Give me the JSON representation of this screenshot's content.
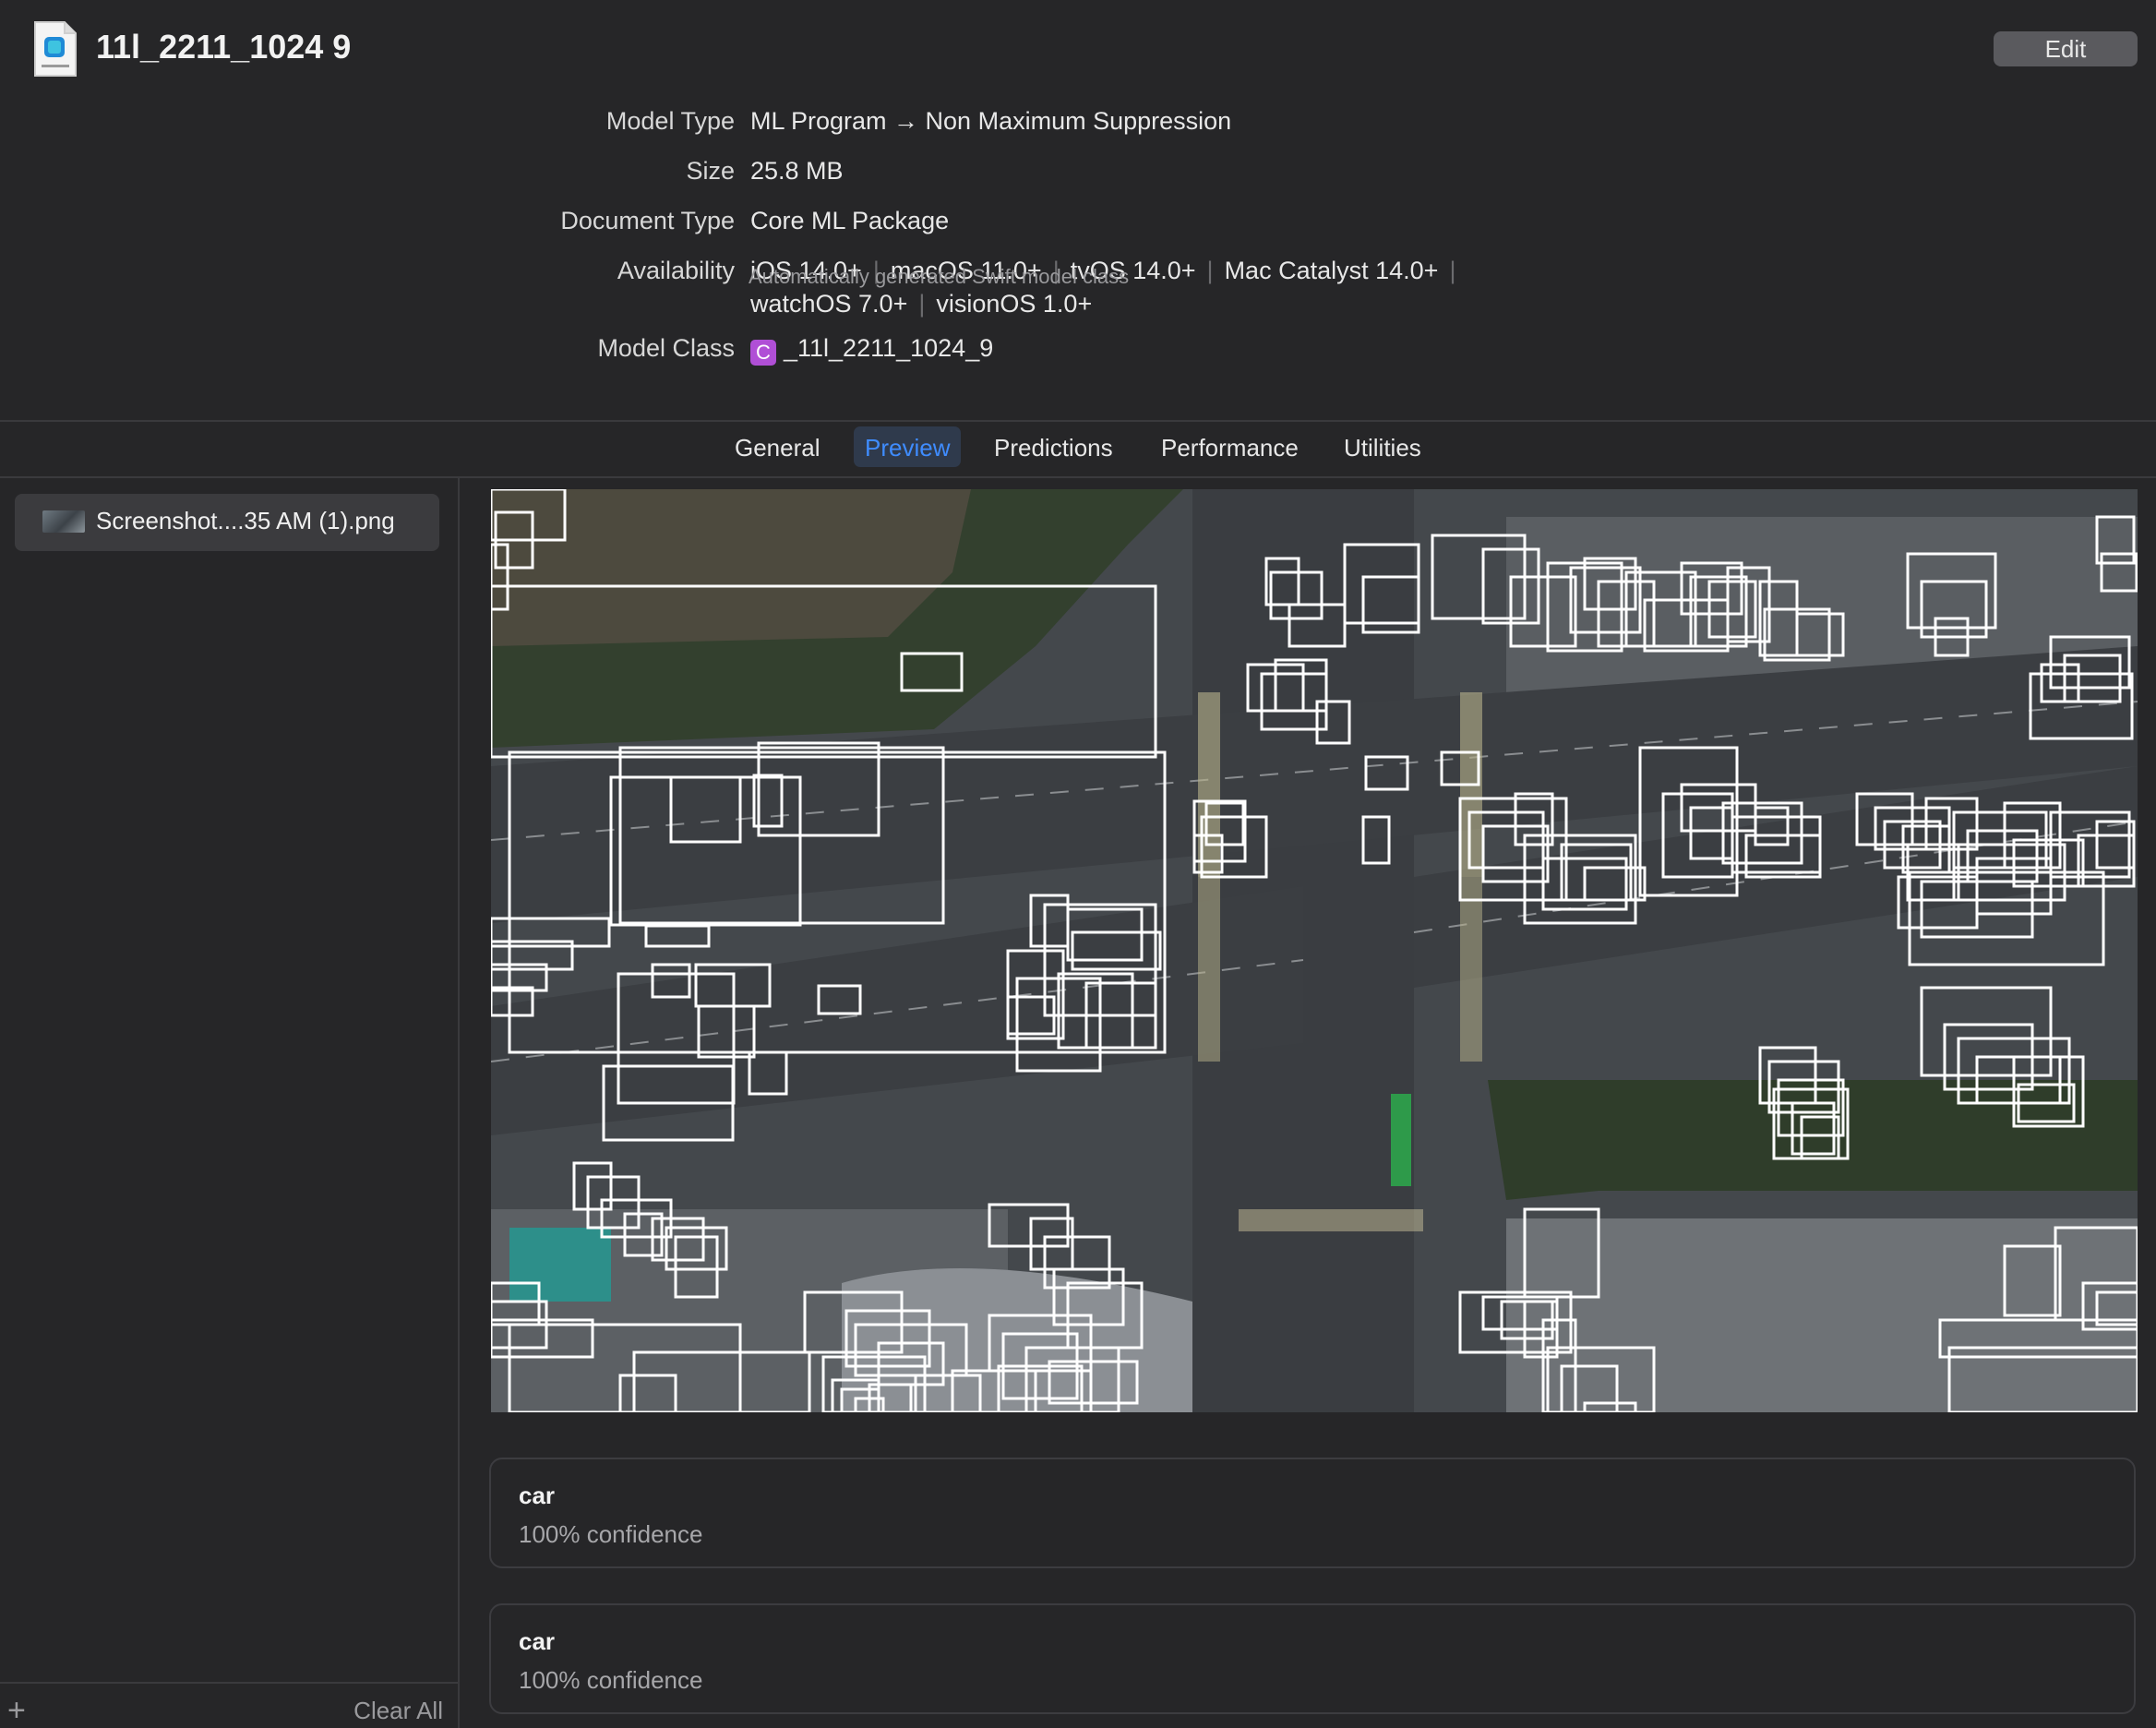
{
  "document": {
    "title": "11l_2211_1024 9",
    "file_icon": "mlpackage-file-icon",
    "edit_label": "Edit"
  },
  "metadata": {
    "model_type_label": "Model Type",
    "model_type_value": "ML Program → Non Maximum Suppression",
    "size_label": "Size",
    "size_value": "25.8 MB",
    "document_type_label": "Document Type",
    "document_type_value": "Core ML Package",
    "availability_label": "Availability",
    "availability_line1": [
      "iOS 14.0+",
      "macOS 11.0+",
      "tvOS 14.0+",
      "Mac Catalyst 14.0+"
    ],
    "availability_line2": [
      "watchOS 7.0+",
      "visionOS 1.0+"
    ],
    "model_class_label": "Model Class",
    "model_class_badge": "C",
    "model_class_value": "_11l_2211_1024_9",
    "model_class_note": "Automatically generated Swift model class"
  },
  "tabs": [
    {
      "label": "General",
      "active": false
    },
    {
      "label": "Preview",
      "active": true
    },
    {
      "label": "Predictions",
      "active": false
    },
    {
      "label": "Performance",
      "active": false
    },
    {
      "label": "Utilities",
      "active": false
    }
  ],
  "sidebar": {
    "files": [
      {
        "name": "Screenshot....35 AM (1).png",
        "selected": true
      }
    ],
    "add_icon": "plus-icon",
    "clear_all_label": "Clear All"
  },
  "preview": {
    "image_description_icon": "aerial-intersection-image",
    "box_color": "#ffffff"
  },
  "results": [
    {
      "label": "car",
      "confidence": "100% confidence"
    },
    {
      "label": "car",
      "confidence": "100% confidence"
    }
  ],
  "colors": {
    "background": "#262628",
    "accent": "#3f8cff",
    "badge": "#b04fd6"
  }
}
